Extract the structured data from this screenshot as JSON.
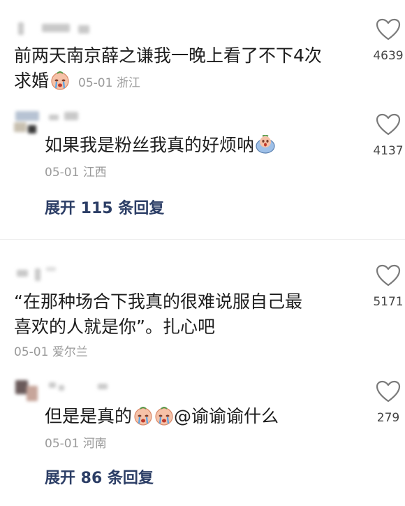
{
  "comments": [
    {
      "text_line1": "前两天南京薛之谦我一晚上看了不下4次",
      "text_line2": "求婚",
      "date": "05-01",
      "location": "浙江",
      "likes": "4639",
      "emoji": "crying-face-icon"
    },
    {
      "text": "如果我是粉丝我真的好烦呐",
      "date": "05-01",
      "location": "江西",
      "likes": "4137",
      "emoji": "screaming-face-icon",
      "expand_label": "展开 115 条回复"
    },
    {
      "text_line1": "“在那种场合下我真的很难说服自己最",
      "text_line2": "喜欢的人就是你”。扎心吧",
      "date": "05-01",
      "location": "爱尔兰",
      "likes": "5171"
    },
    {
      "text_prefix": "但是是真的",
      "text_suffix": "@谕谕谕什么",
      "date": "05-01",
      "location": "河南",
      "likes": "279",
      "emoji": "crying-face-icon",
      "expand_label": "展开 86 条回复"
    }
  ],
  "colors": {
    "expand_link": "#2c3e66",
    "meta_gray": "#9a9a9a",
    "heart_outline": "#7a7a7a"
  }
}
